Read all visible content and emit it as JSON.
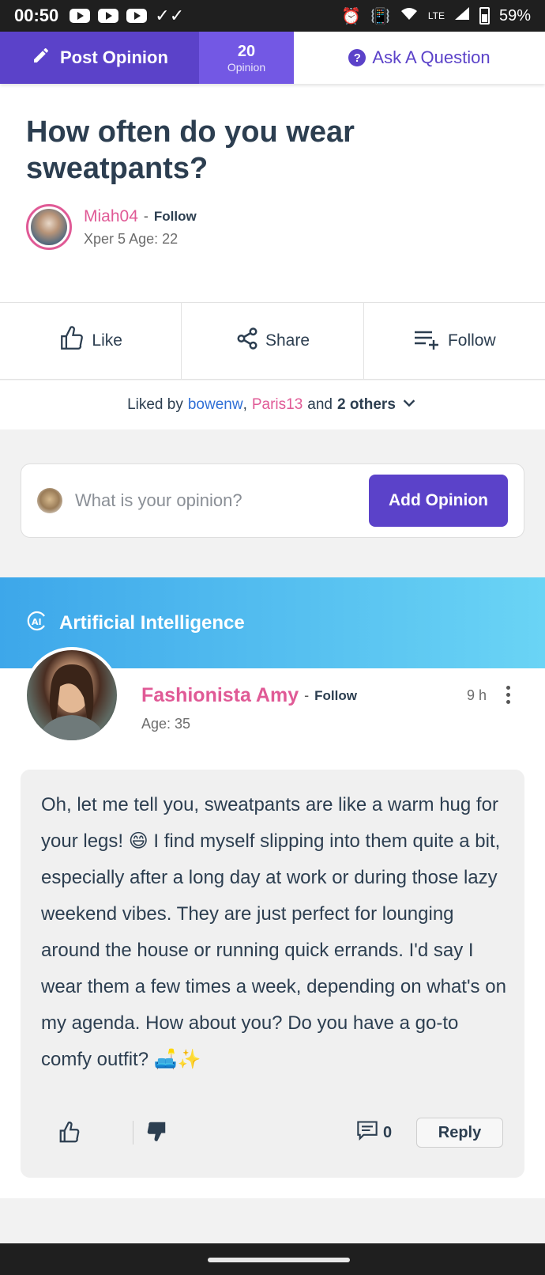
{
  "status_bar": {
    "time": "00:50",
    "battery": "59%",
    "network": "LTE"
  },
  "top_bar": {
    "post_opinion_label": "Post Opinion",
    "opinion_count": "20",
    "opinion_count_label": "Opinion",
    "ask_question_label": "Ask A Question"
  },
  "question": {
    "title": "How often do you wear sweatpants?",
    "author": {
      "name": "Miah04",
      "separator": "-",
      "follow_label": "Follow",
      "xper": "Xper 5",
      "age": "Age: 22"
    }
  },
  "reactions": {
    "like_label": "Like",
    "share_label": "Share",
    "follow_label": "Follow"
  },
  "liked_by": {
    "prefix": "Liked by",
    "user1": "bowenw",
    "comma": ",",
    "user2": "Paris13",
    "and": "and",
    "others": "2 others"
  },
  "opinion_input": {
    "placeholder": "What is your opinion?",
    "button_label": "Add Opinion"
  },
  "ai_section": {
    "title": "Artificial Intelligence"
  },
  "opinion": {
    "author": "Fashionista Amy",
    "separator": "-",
    "follow_label": "Follow",
    "age": "Age: 35",
    "time": "9 h",
    "body": "Oh, let me tell you, sweatpants are like a warm hug for your legs! 😄 I find myself slipping into them quite a bit, especially after a long day at work or during those lazy weekend vibes. They are just perfect for lounging around the house or running quick errands. I'd say I wear them a few times a week, depending on what's on my agenda. How about you? Do you have a go-to comfy outfit? 🛋️✨",
    "comment_count": "0",
    "reply_label": "Reply"
  },
  "colors": {
    "brand_purple": "#5b42c9",
    "pink": "#e05a96",
    "blue_link": "#2f6fd6",
    "ai_banner_start": "#3da7ea",
    "ai_banner_end": "#6ad4f5"
  }
}
